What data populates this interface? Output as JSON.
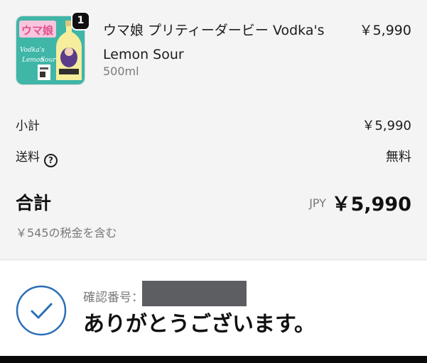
{
  "order_summary": {
    "item": {
      "quantity": "1",
      "name": "ウマ娘 プリティーダービー Vodka's Lemon Sour",
      "variant": "500ml",
      "price": "￥5,990",
      "image": "product-thumbnail",
      "image_text": [
        "ウマ娘",
        "Vodka's",
        "Lemon",
        "Sour"
      ]
    },
    "subtotal": {
      "label": "小計",
      "value": "￥5,990"
    },
    "shipping": {
      "label": "送料",
      "value": "無料",
      "help_icon": "question-circle-icon"
    },
    "total": {
      "label": "合計",
      "currency": "JPY",
      "value": "￥5,990"
    },
    "tax_note": "￥545の税金を含む"
  },
  "confirmation": {
    "icon": "check-circle-icon",
    "number_label": "確認番号：",
    "message": "ありがとうございます。"
  },
  "colors": {
    "summary_background": "#f4f4f4",
    "check_color": "#2a6fb8",
    "redaction": "#5d5e61",
    "thumbnail_teal": "#3fb6a8"
  }
}
